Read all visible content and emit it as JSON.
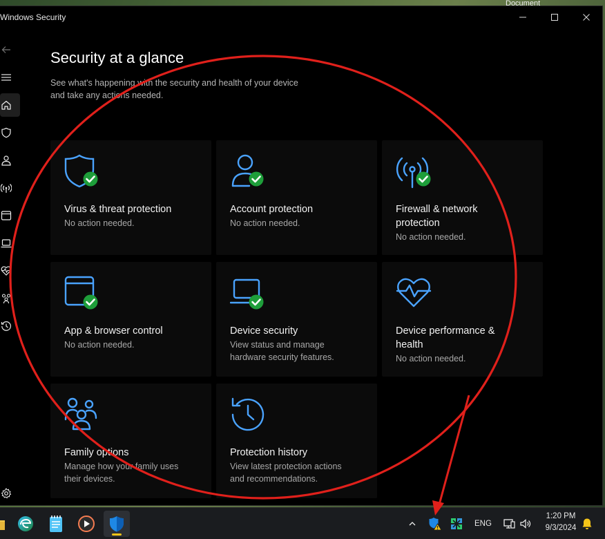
{
  "window": {
    "title": "Windows Security"
  },
  "desktop": {
    "corner_label": "Document"
  },
  "page": {
    "title": "Security at a glance",
    "subtitle_line1": "See what's happening with the security and health of your device",
    "subtitle_line2": "and take any actions needed."
  },
  "tiles": [
    {
      "name": "Virus & threat protection",
      "desc": "No action needed.",
      "icon": "shield-check-icon"
    },
    {
      "name": "Account protection",
      "desc": "No action needed.",
      "icon": "account-check-icon"
    },
    {
      "name_line1": "Firewall & network",
      "name_line2": "protection",
      "desc": "No action needed.",
      "icon": "wireless-signal-check-icon"
    },
    {
      "name": "App & browser control",
      "desc": "No action needed.",
      "icon": "app-window-check-icon"
    },
    {
      "name": "Device security",
      "desc_line1": "View status and manage",
      "desc_line2": "hardware security features.",
      "icon": "laptop-check-icon"
    },
    {
      "name_line1": "Device performance &",
      "name_line2": "health",
      "desc": "No action needed.",
      "icon": "heart-pulse-icon"
    },
    {
      "name": "Family options",
      "desc_line1": "Manage how your family uses",
      "desc_line2": "their devices.",
      "icon": "family-icon"
    },
    {
      "name": "Protection history",
      "desc_line1": "View latest protection actions",
      "desc_line2": "and recommendations.",
      "icon": "history-icon"
    }
  ],
  "taskbar": {
    "language": "ENG",
    "time": "1:20 PM",
    "date": "9/3/2024"
  },
  "colors": {
    "accent_blue": "#4aa3ff",
    "check_green": "#1e9e3a",
    "annotation_red": "#e0201b",
    "warning_yellow": "#f5c518"
  }
}
